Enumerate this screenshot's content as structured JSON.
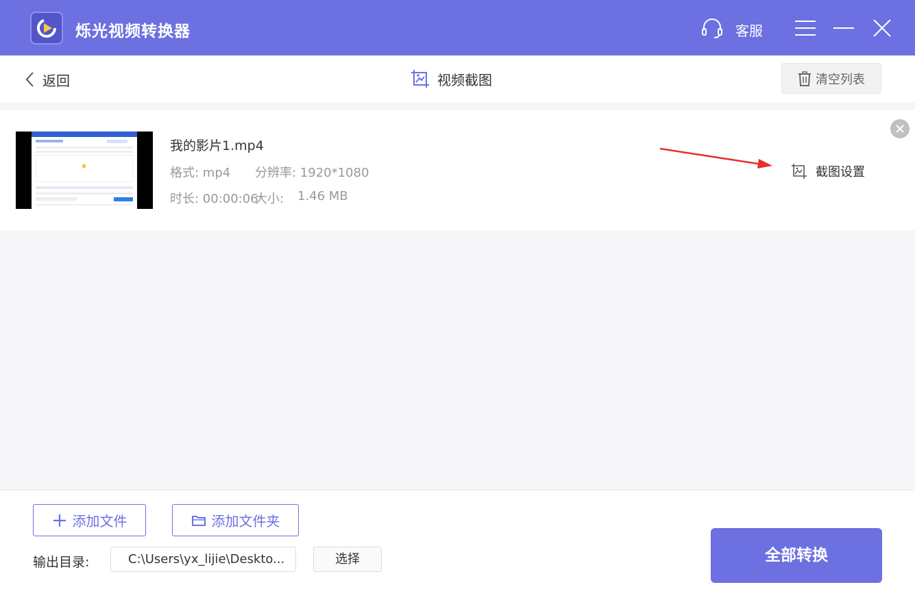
{
  "app": {
    "title": "烁光视频转换器",
    "service_label": "客服"
  },
  "header": {
    "back_label": "返回",
    "page_title": "视频截图",
    "clear_label": "清空列表"
  },
  "file": {
    "name": "我的影片1.mp4",
    "format": "格式: mp4",
    "resolution": "分辨率: 1920*1080",
    "duration": "时长: 00:00:06",
    "size_label": "大小:",
    "size_value": "1.46 MB",
    "screenshot_settings": "截图设置"
  },
  "bottom": {
    "add_file": "添加文件",
    "add_folder": "添加文件夹",
    "output_label": "输出目录:",
    "output_path": "C:\\Users\\yx_lijie\\Deskto...",
    "choose_label": "选择",
    "convert_all": "全部转换"
  },
  "colors": {
    "accent": "#6c70e0",
    "annotation_arrow": "#e8302b"
  },
  "icons": [
    "app-logo-icon",
    "headset-icon",
    "menu-icon",
    "minimize-icon",
    "close-icon",
    "chevron-left-icon",
    "image-crop-icon",
    "trash-icon",
    "remove-circle-icon",
    "screenshot-icon",
    "plus-icon",
    "folder-icon"
  ]
}
